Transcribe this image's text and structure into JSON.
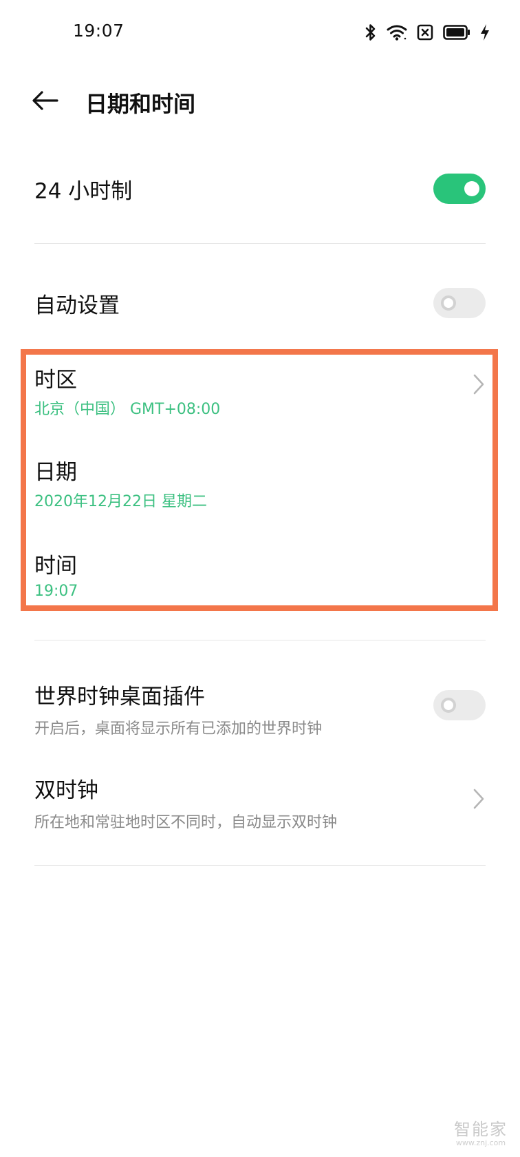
{
  "status_bar": {
    "time": "19:07",
    "icons": [
      "bluetooth-icon",
      "wifi-icon",
      "sim-off-icon",
      "battery-icon",
      "charging-icon"
    ]
  },
  "header": {
    "title": "日期和时间",
    "back_icon": "arrow-left-icon"
  },
  "settings": {
    "hour24": {
      "label": "24 小时制",
      "enabled": true
    },
    "auto_set": {
      "label": "自动设置",
      "enabled": false
    },
    "timezone": {
      "label": "时区",
      "value": "北京（中国） GMT+08:00"
    },
    "date": {
      "label": "日期",
      "value": "2020年12月22日 星期二"
    },
    "time": {
      "label": "时间",
      "value": "19:07"
    },
    "world_clock_widget": {
      "label": "世界时钟桌面插件",
      "description": "开启后，桌面将显示所有已添加的世界时钟",
      "enabled": false
    },
    "dual_clock": {
      "label": "双时钟",
      "description": "所在地和常驻地时区不同时，自动显示双时钟"
    }
  },
  "watermark": {
    "name": "智能家",
    "url": "www.znj.com"
  },
  "colors": {
    "accent_green": "#3cc081",
    "toggle_on": "#29c47a",
    "highlight_box": "#f3764a",
    "divider": "#e5e5e5"
  }
}
